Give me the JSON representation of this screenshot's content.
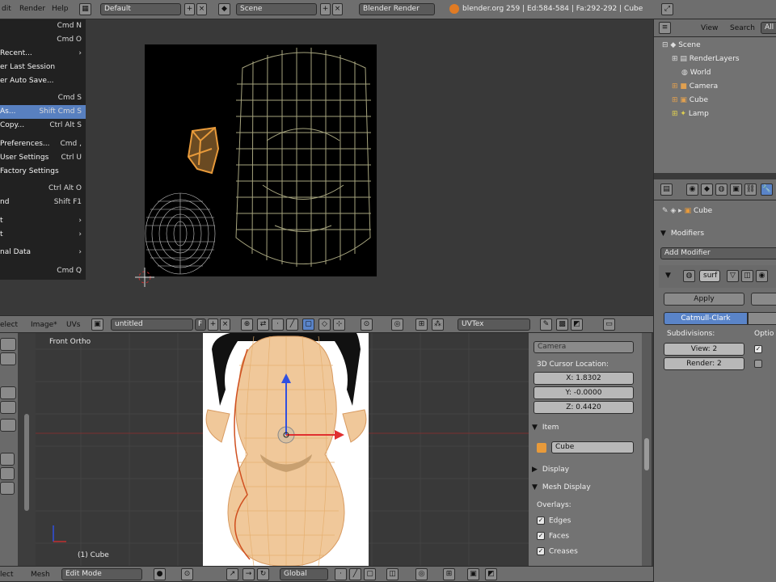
{
  "topbar": {
    "menus": [
      "dit",
      "Render",
      "Help"
    ],
    "screen": "Default",
    "scene": "Scene",
    "engine": "Blender Render",
    "stats": "blender.org 259 | Ed:584-584 | Fa:292-292 | Cube"
  },
  "file_menu": [
    {
      "label": "",
      "key": "Cmd N"
    },
    {
      "label": "",
      "key": "Cmd O"
    },
    {
      "label": "Recent...",
      "key": "›"
    },
    {
      "label": "er Last Session",
      "key": ""
    },
    {
      "label": "er Auto Save...",
      "key": ""
    },
    {
      "label": "",
      "key": "Cmd S"
    },
    {
      "label": "As...",
      "key": "Shift Cmd S",
      "highlight": true
    },
    {
      "label": "Copy...",
      "key": "Ctrl Alt S"
    },
    {
      "label": "Preferences...",
      "key": "Cmd ,"
    },
    {
      "label": "User Settings",
      "key": "Ctrl U"
    },
    {
      "label": "Factory Settings",
      "key": ""
    },
    {
      "label": "",
      "key": "Ctrl Alt O"
    },
    {
      "label": "nd",
      "key": "Shift F1"
    },
    {
      "label": "t",
      "key": "›"
    },
    {
      "label": "t",
      "key": "›"
    },
    {
      "label": "nal Data",
      "key": "›"
    },
    {
      "label": "",
      "key": "Cmd Q"
    }
  ],
  "uv_header": {
    "menus": [
      "elect",
      "Image*",
      "UVs"
    ],
    "image": "untitled",
    "image_f": "F",
    "uvtex": "UVTex"
  },
  "viewport": {
    "label": "Front Ortho",
    "object_label": "(1) Cube"
  },
  "bottom_header": {
    "menus": [
      "lect",
      "Mesh"
    ],
    "mode": "Edit Mode",
    "orientation": "Global"
  },
  "npanel": {
    "camera": "Camera",
    "cursor_title": "3D Cursor Location:",
    "x": "X: 1.8302",
    "y": "Y: -0.0000",
    "z": "Z: 0.4420",
    "item_title": "Item",
    "item_name": "Cube",
    "display": "Display",
    "mesh_display": "Mesh Display",
    "overlays": "Overlays:",
    "edges": "Edges",
    "faces": "Faces",
    "creases": "Creases"
  },
  "outliner": {
    "view": "View",
    "search": "Search",
    "all": "All",
    "items": [
      "Scene",
      "RenderLayers",
      "World",
      "Camera",
      "Cube",
      "Lamp"
    ]
  },
  "properties": {
    "breadcrumb": "Cube",
    "modifiers": "Modifiers",
    "add_modifier": "Add Modifier",
    "surf": "surf",
    "apply": "Apply",
    "type": "Catmull-Clark",
    "subdivisions": "Subdivisions:",
    "options": "Optio",
    "view": "View: 2",
    "render": "Render: 2"
  },
  "colors": {
    "accent": "#5a84c8",
    "select": "#e89a3a",
    "background": "#393939"
  }
}
